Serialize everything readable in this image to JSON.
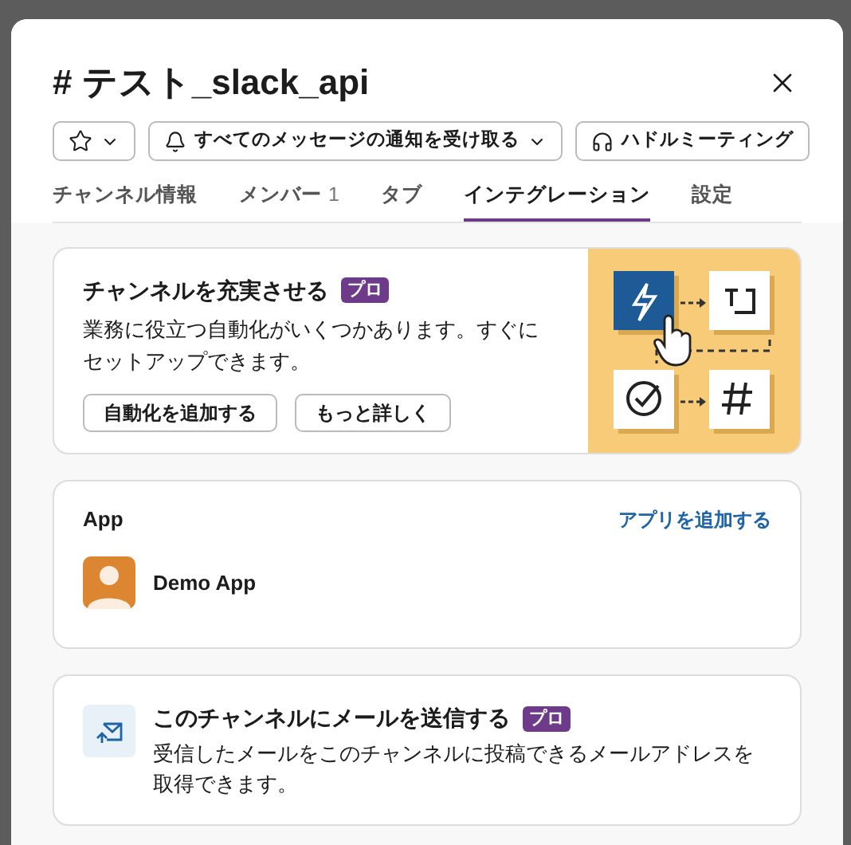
{
  "dialog": {
    "title": "# テスト_slack_api"
  },
  "actions": [
    {
      "kind": "star"
    },
    {
      "kind": "notify",
      "label": "すべてのメッセージの通知を受け取る"
    },
    {
      "kind": "huddle",
      "label": "ハドルミーティング"
    }
  ],
  "tabs": [
    {
      "label": "チャンネル情報",
      "selected": false
    },
    {
      "label": "メンバー",
      "count": "1",
      "selected": false
    },
    {
      "label": "タブ",
      "selected": false
    },
    {
      "label": "インテグレーション",
      "selected": true
    },
    {
      "label": "設定",
      "selected": false
    }
  ],
  "promo": {
    "title": "チャンネルを充実させる",
    "badge": "プロ",
    "text": "業務に役立つ自動化がいくつかあります。すぐにセットアップできます。",
    "buttons": [
      "自動化を追加する",
      "もっと詳しく"
    ]
  },
  "apps": {
    "title": "App",
    "add_link": "アプリを追加する",
    "items": [
      {
        "name": "Demo App"
      }
    ]
  },
  "email": {
    "title": "このチャンネルにメールを送信する",
    "badge": "プロ",
    "text": "受信したメールをこのチャンネルに投稿できるメールアドレスを取得できます。"
  }
}
